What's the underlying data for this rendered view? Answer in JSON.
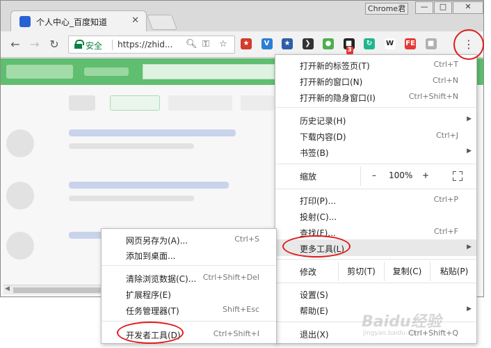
{
  "browser": {
    "tab": {
      "title": "个人中心_百度知道",
      "favicon": "paw-icon"
    },
    "profile_name": "Chrome君",
    "window_buttons": {
      "minimize": "—",
      "maximize": "□",
      "close": "✕"
    },
    "omnibox": {
      "secure_label": "安全",
      "url": "https://zhid..."
    },
    "extensions": [
      {
        "name": "flag-ext-icon",
        "color": "#d33b2c",
        "glyph": "★"
      },
      {
        "name": "v-ext-icon",
        "color": "#2a7fd4",
        "glyph": "V"
      },
      {
        "name": "star-ext-icon",
        "color": "#2f5ea8",
        "glyph": "★"
      },
      {
        "name": "dark-ext-icon",
        "color": "#333333",
        "glyph": "❯"
      },
      {
        "name": "circle-ext-icon",
        "color": "#4caf50",
        "glyph": "●"
      },
      {
        "name": "notes-ext-icon",
        "color": "#222222",
        "glyph": "■",
        "badge": "3"
      },
      {
        "name": "sync-ext-icon",
        "color": "#20b58f",
        "glyph": "↻"
      },
      {
        "name": "w-ext-icon",
        "color": "#ffffff",
        "glyph": "W"
      },
      {
        "name": "fe-ext-icon",
        "color": "#e53935",
        "glyph": "FE"
      },
      {
        "name": "gray-ext-icon",
        "color": "#b0b0b0",
        "glyph": "■"
      }
    ]
  },
  "main_menu": {
    "group1": [
      {
        "label": "打开新的标签页(T)",
        "shortcut": "Ctrl+T"
      },
      {
        "label": "打开新的窗口(N)",
        "shortcut": "Ctrl+N"
      },
      {
        "label": "打开新的隐身窗口(I)",
        "shortcut": "Ctrl+Shift+N"
      }
    ],
    "group2": [
      {
        "label": "历史记录(H)",
        "shortcut": ""
      },
      {
        "label": "下载内容(D)",
        "shortcut": "Ctrl+J"
      },
      {
        "label": "书签(B)",
        "shortcut": ""
      }
    ],
    "zoom": {
      "label": "缩放",
      "minus": "–",
      "value": "100%",
      "plus": "+"
    },
    "group3": [
      {
        "label": "打印(P)...",
        "shortcut": "Ctrl+P"
      },
      {
        "label": "投射(C)...",
        "shortcut": ""
      },
      {
        "label": "查找(F)...",
        "shortcut": "Ctrl+F"
      },
      {
        "label": "更多工具(L)",
        "shortcut": ""
      }
    ],
    "edit": {
      "label": "修改",
      "cut": "剪切(T)",
      "copy": "复制(C)",
      "paste": "粘贴(P)"
    },
    "group4": [
      {
        "label": "设置(S)",
        "shortcut": ""
      },
      {
        "label": "帮助(E)",
        "shortcut": ""
      }
    ],
    "exit": {
      "label": "退出(X)",
      "shortcut": "Ctrl+Shift+Q"
    }
  },
  "sub_menu": {
    "group1": [
      {
        "label": "网页另存为(A)...",
        "shortcut": "Ctrl+S"
      },
      {
        "label": "添加到桌面...",
        "shortcut": ""
      }
    ],
    "group2": [
      {
        "label": "清除浏览数据(C)...",
        "shortcut": "Ctrl+Shift+Del"
      },
      {
        "label": "扩展程序(E)",
        "shortcut": ""
      },
      {
        "label": "任务管理器(T)",
        "shortcut": "Shift+Esc"
      }
    ],
    "group3": [
      {
        "label": "开发者工具(D)",
        "shortcut": "Ctrl+Shift+I"
      }
    ]
  },
  "watermark": {
    "brand": "Baidu经验",
    "sub": "jingyan.baidu.com"
  },
  "colors": {
    "accent_circle": "#e01b1b",
    "page_header": "#5fbe6f",
    "secure_green": "#0b8043"
  }
}
